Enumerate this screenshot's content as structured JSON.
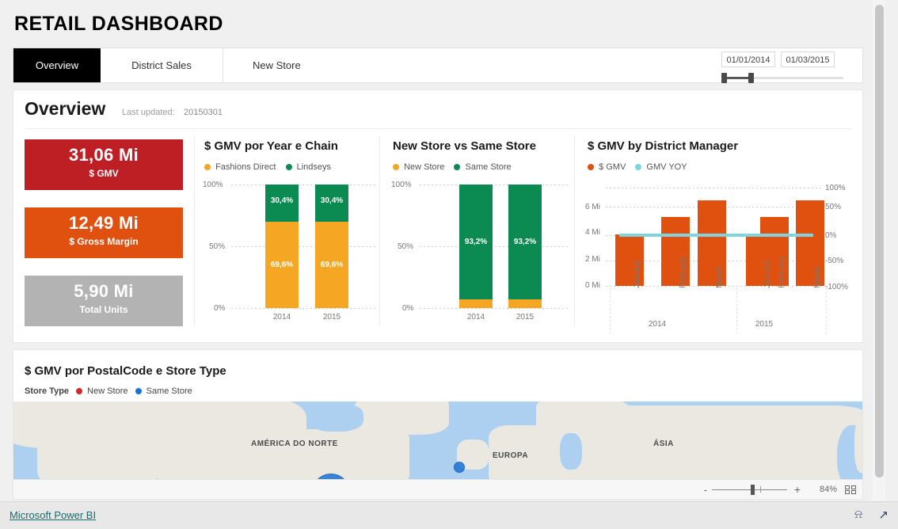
{
  "header": {
    "title": "RETAIL DASHBOARD",
    "tabs": [
      {
        "label": "Overview",
        "active": true
      },
      {
        "label": "District Sales",
        "active": false
      },
      {
        "label": "New Store",
        "active": false
      }
    ],
    "date_range": {
      "start": "01/01/2014",
      "end": "01/03/2015"
    }
  },
  "overview": {
    "title": "Overview",
    "last_updated_label": "Last updated:",
    "last_updated_value": "20150301",
    "kpis": [
      {
        "value": "31,06 Mi",
        "label": "$ GMV",
        "color": "#bd1f24"
      },
      {
        "value": "12,49 Mi",
        "label": "$ Gross Margin",
        "color": "#e0510f"
      },
      {
        "value": "5,90 Mi",
        "label": "Total Units",
        "color": "#b3b3b3"
      }
    ]
  },
  "chart_data": [
    {
      "type": "bar",
      "title": "$ GMV por Year e Chain",
      "stacked": true,
      "stack_mode": "percent",
      "categories": [
        "2014",
        "2015"
      ],
      "series": [
        {
          "name": "Fashions Direct",
          "color": "#f5a623",
          "values": [
            69.6,
            69.6
          ],
          "labels": [
            "69,6%",
            "69,6%"
          ]
        },
        {
          "name": "Lindseys",
          "color": "#0b8a52",
          "values": [
            30.4,
            30.4
          ],
          "labels": [
            "30,4%",
            "30,4%"
          ]
        }
      ],
      "ylabel": "",
      "xlabel": "",
      "yticks": [
        "100%",
        "50%",
        "0%"
      ],
      "ylim": [
        0,
        100
      ],
      "grid": true,
      "legend_position": "top"
    },
    {
      "type": "bar",
      "title": "New Store vs Same Store",
      "stacked": true,
      "stack_mode": "percent",
      "categories": [
        "2014",
        "2015"
      ],
      "series": [
        {
          "name": "New Store",
          "color": "#f5a623",
          "values": [
            6.8,
            6.8
          ],
          "labels": [
            "",
            ""
          ]
        },
        {
          "name": "Same Store",
          "color": "#0b8a52",
          "values": [
            93.2,
            93.2
          ],
          "labels": [
            "93,2%",
            "93,2%"
          ]
        }
      ],
      "ylabel": "",
      "xlabel": "",
      "yticks": [
        "100%",
        "50%",
        "0%"
      ],
      "ylim": [
        0,
        100
      ],
      "grid": true,
      "legend_position": "top"
    },
    {
      "type": "bar",
      "title": "$ GMV by District Manager",
      "categories": [
        "January",
        "February",
        "March",
        "January",
        "February",
        "March"
      ],
      "category_groups": [
        {
          "label": "2014",
          "span": 3
        },
        {
          "label": "2015",
          "span": 3
        }
      ],
      "series": [
        {
          "name": "$ GMV",
          "color": "#e0510f",
          "kind": "bar",
          "values": [
            3.9,
            5.2,
            6.5,
            3.9,
            5.2,
            6.5
          ]
        },
        {
          "name": "GMV YOY",
          "color": "#7fd4e0",
          "kind": "line",
          "values": [
            0,
            0,
            0,
            0,
            0,
            0
          ]
        }
      ],
      "ylabel": "",
      "xlabel": "",
      "yticks": [
        "6 Mi",
        "4 Mi",
        "2 Mi",
        "0 Mi"
      ],
      "ylim": [
        0,
        8
      ],
      "y2ticks": [
        "100%",
        "50%",
        "0%",
        "-50%",
        "-100%"
      ],
      "y2lim": [
        -100,
        100
      ],
      "grid": true,
      "legend_position": "top"
    },
    {
      "type": "map",
      "title": "$ GMV por PostalCode e Store Type",
      "legend_title": "Store Type",
      "series": [
        {
          "name": "New Store",
          "color": "#d02b2b"
        },
        {
          "name": "Same Store",
          "color": "#1a72d8"
        }
      ],
      "region_labels": [
        "AMÉRICA DO NORTE",
        "EUROPA",
        "ÁSIA"
      ]
    }
  ],
  "zoombar": {
    "minus": "-",
    "plus": "+",
    "percent": "84%"
  },
  "footer": {
    "link": "Microsoft Power BI",
    "share_icon": "share-icon",
    "expand_icon": "expand-icon"
  }
}
